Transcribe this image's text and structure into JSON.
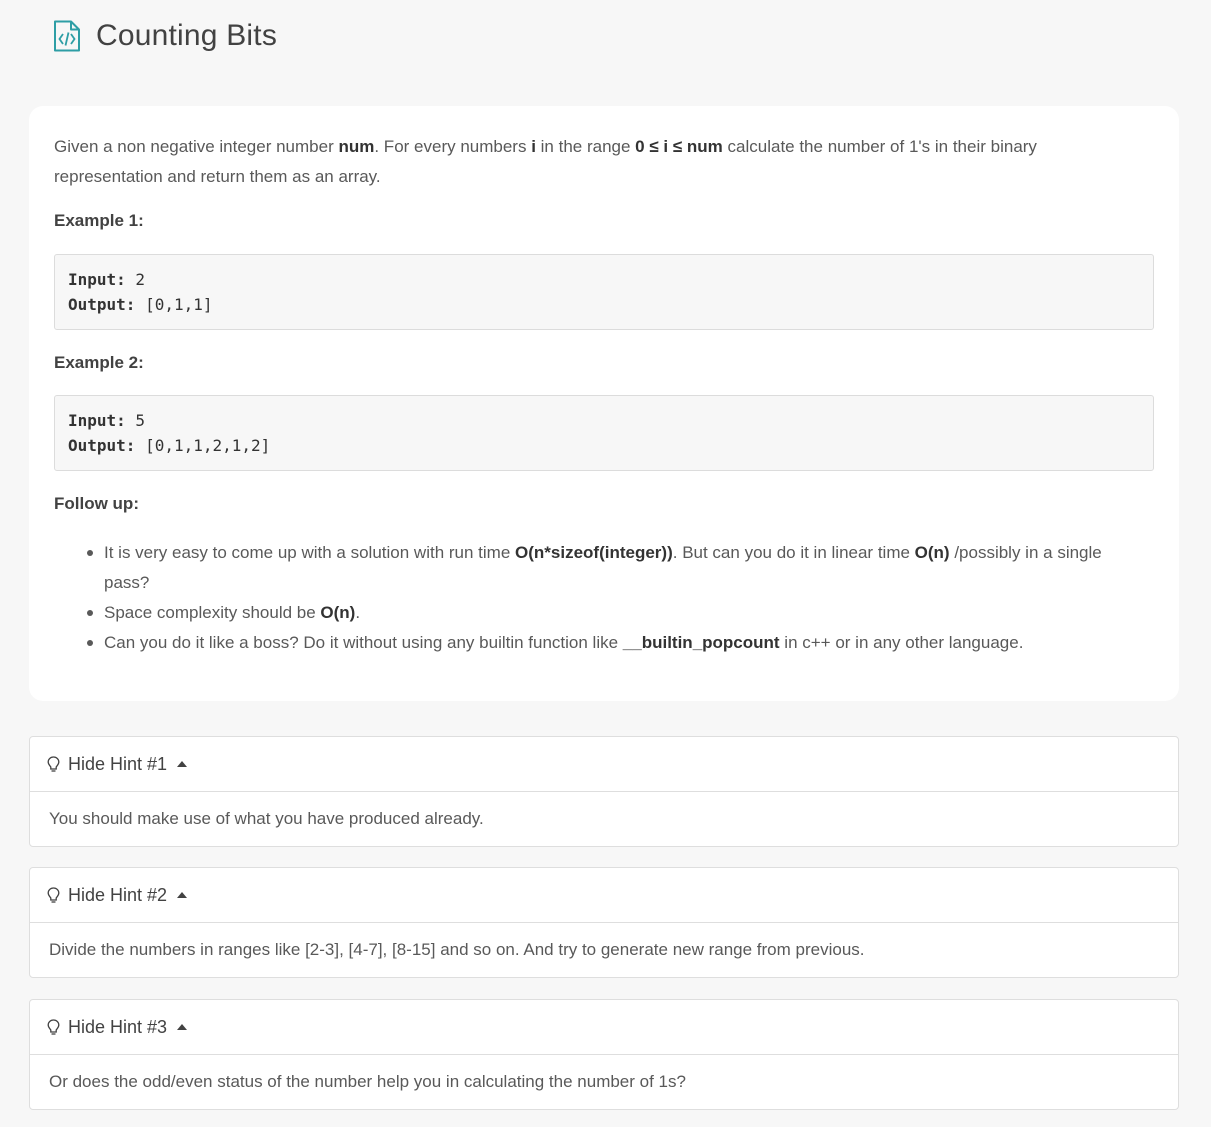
{
  "header": {
    "title": "Counting Bits",
    "icon": "code-file-icon",
    "accent_color": "#2e9ea5"
  },
  "description": {
    "p1": "Given a non negative integer number ",
    "num": "num",
    "p2": ". For every numbers ",
    "i": "i",
    "p3": " in the range ",
    "range": "0 ≤ i ≤ num",
    "p4": " calculate the number of 1's in their binary representation and return them as an array."
  },
  "examples": [
    {
      "title": "Example 1:",
      "input_label": "Input:",
      "input": " 2",
      "output_label": "Output:",
      "output": " [0,1,1]"
    },
    {
      "title": "Example 2:",
      "input_label": "Input:",
      "input": " 5",
      "output_label": "Output:",
      "output": " [0,1,1,2,1,2]"
    }
  ],
  "follow_up": {
    "title": "Follow up:",
    "items": [
      {
        "a": "It is very easy to come up with a solution with run time ",
        "b": "O(n*sizeof(integer))",
        "c": ". But can you do it in linear time ",
        "d": "O(n)",
        "e": " /possibly in a single pass?"
      },
      {
        "a": "Space complexity should be ",
        "b": "O(n)",
        "c": "."
      },
      {
        "a": "Can you do it like a boss? Do it without using any builtin function like ",
        "b": "__builtin_popcount",
        "c": " in c++ or in any other language."
      }
    ]
  },
  "hints": [
    {
      "label": "Hide Hint #1",
      "text": "You should make use of what you have produced already.",
      "icon": "bulb-icon",
      "toggle_icon": "caret-up-icon"
    },
    {
      "label": "Hide Hint #2",
      "text": "Divide the numbers in ranges like [2-3], [4-7], [8-15] and so on. And try to generate new range from previous.",
      "icon": "bulb-icon",
      "toggle_icon": "caret-up-icon"
    },
    {
      "label": "Hide Hint #3",
      "text": "Or does the odd/even status of the number help you in calculating the number of 1s?",
      "icon": "bulb-icon",
      "toggle_icon": "caret-up-icon"
    }
  ]
}
